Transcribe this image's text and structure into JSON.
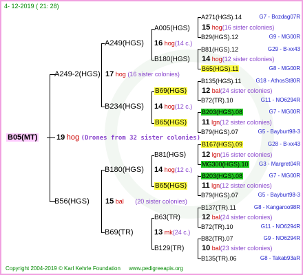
{
  "header": {
    "date": "4- 12-2019",
    "time": "( 21: 28)"
  },
  "root": {
    "name": "B05(MT)",
    "num": "19",
    "hog": "hog",
    "desc": "(Drones from 32 sister colonies)"
  },
  "gen1": [
    {
      "name": "A249-2(HGS)",
      "num": "17",
      "hog": "hog",
      "desc": "(16 sister colonies)"
    },
    {
      "name": "B56(HGS)",
      "num": "15",
      "hog": "bal",
      "desc": "(20 sister colonies)"
    }
  ],
  "gen2": [
    {
      "name": "A249(HGS)",
      "num": "16",
      "hog": "hog",
      "desc": "(14 c.)"
    },
    {
      "name": "B234(HGS)",
      "num": "14",
      "hog": "hog",
      "desc": "(12 c.)"
    },
    {
      "name": "B180(HGS)",
      "num": "14",
      "hog": "hog",
      "desc": "(12 c.)"
    },
    {
      "name": "B69(TR)",
      "num": "13",
      "hog": "mk",
      "desc": "(24 c.)"
    }
  ],
  "gen3": [
    {
      "name": "A005(HGS)",
      "hl": ""
    },
    {
      "name": "B180(HGS)",
      "hl": ""
    },
    {
      "name": "B69(HGS)",
      "hl": "yellow"
    },
    {
      "name": "B65(HGS)",
      "hl": "yellow"
    },
    {
      "name": "B81(HGS)",
      "hl": ""
    },
    {
      "name": "B65(HGS)",
      "hl": "yellow"
    },
    {
      "name": "B63(TR)",
      "hl": ""
    },
    {
      "name": "B129(TR)",
      "hl": ""
    }
  ],
  "gen3_details": [
    {
      "num": "15",
      "hog": "hog",
      "desc": "(16 sister colonies)"
    },
    {
      "num": "14",
      "hog": "hog",
      "desc": "(12 sister colonies)"
    },
    {
      "num": "12",
      "hog": "bal",
      "desc": "(24 sister colonies)"
    },
    {
      "num": "11",
      "hog": "lgn",
      "desc": "(12 sister colonies)"
    },
    {
      "num": "12",
      "hog": "lgn",
      "desc": "(16 sister colonies)"
    },
    {
      "num": "11",
      "hog": "lgn",
      "desc": "(12 sister colonies)"
    },
    {
      "num": "12",
      "hog": "bal",
      "desc": "(24 sister colonies)"
    },
    {
      "num": "10",
      "hog": "bal",
      "desc": "(23 sister colonies)"
    }
  ],
  "gen4": [
    {
      "name": "A271(HGS).14",
      "hl": "",
      "tag": "G7 - Bozdag07R"
    },
    {
      "name": "B29(HGS).12",
      "hl": "",
      "tag": "G9 - MG00R"
    },
    {
      "name": "B81(HGS).12",
      "hl": "",
      "tag": "G29 - B-xx43"
    },
    {
      "name": "B65(HGS).11",
      "hl": "yellow",
      "tag": "G8 - MG00R"
    },
    {
      "name": "B135(HGS).11",
      "hl": "",
      "tag": "G18 - AthosSt80R"
    },
    {
      "name": "B72(TR).10",
      "hl": "",
      "tag": "G11 - NO6294R"
    },
    {
      "name": "B203(HGS).08",
      "hl": "green",
      "tag": "G7 - MG00R"
    },
    {
      "name": "B79(HGS).07",
      "hl": "",
      "tag": "G5 - Bayburt98-3"
    },
    {
      "name": "B167(HGS).09",
      "hl": "yellow",
      "tag": "G28 - B-xx43"
    },
    {
      "name": "MG300(HGS).10",
      "hl": "green",
      "tag": "G3 - Margret04R"
    },
    {
      "name": "B203(HGS).08",
      "hl": "green",
      "tag": "G7 - MG00R"
    },
    {
      "name": "B79(HGS).07",
      "hl": "",
      "tag": "G5 - Bayburt98-3"
    },
    {
      "name": "B137(TR).11",
      "hl": "",
      "tag": "G8 - Kangaroo98R"
    },
    {
      "name": "B72(TR).10",
      "hl": "",
      "tag": "G11 - NO6294R"
    },
    {
      "name": "B82(TR).07",
      "hl": "",
      "tag": "G9 - NO6294R"
    },
    {
      "name": "B135(TR).06",
      "hl": "",
      "tag": "G8 - Takab93aR"
    }
  ],
  "footer": {
    "copyright": "Copyright 2004-2019 © Karl Kehrle Foundation",
    "url": "www.pedigreeapis.org"
  }
}
